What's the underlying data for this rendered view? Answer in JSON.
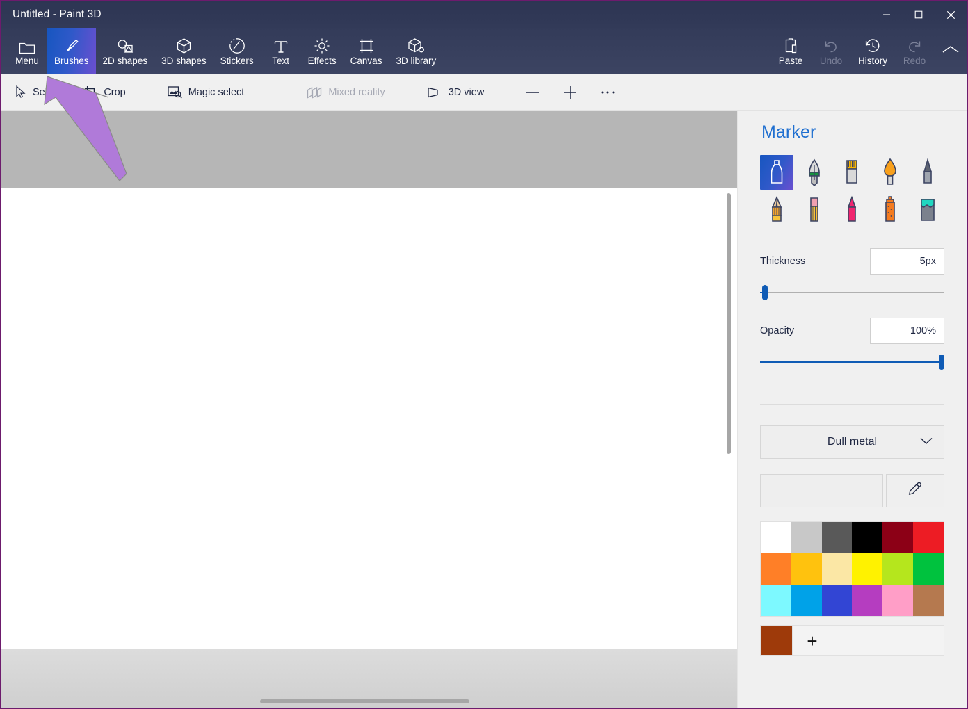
{
  "window": {
    "title": "Untitled - Paint 3D",
    "controls": [
      {
        "name": "minimize",
        "label": "Minimize"
      },
      {
        "name": "maximize",
        "label": "Maximize"
      },
      {
        "name": "close",
        "label": "Close"
      }
    ]
  },
  "ribbon": {
    "items": [
      {
        "label": "Menu",
        "icon": "folder-icon",
        "state": "normal",
        "name": "menu"
      },
      {
        "label": "Brushes",
        "icon": "brush-icon",
        "state": "selected",
        "name": "brushes"
      },
      {
        "label": "2D shapes",
        "icon": "shapes-2d-icon",
        "state": "normal",
        "name": "2d-shapes"
      },
      {
        "label": "3D shapes",
        "icon": "cube-icon",
        "state": "normal",
        "name": "3d-shapes"
      },
      {
        "label": "Stickers",
        "icon": "sticker-icon",
        "state": "normal",
        "name": "stickers"
      },
      {
        "label": "Text",
        "icon": "text-icon",
        "state": "normal",
        "name": "text"
      },
      {
        "label": "Effects",
        "icon": "sun-icon",
        "state": "normal",
        "name": "effects"
      },
      {
        "label": "Canvas",
        "icon": "canvas-icon",
        "state": "normal",
        "name": "canvas"
      },
      {
        "label": "3D library",
        "icon": "3d-library-icon",
        "state": "normal",
        "name": "3d-library"
      }
    ],
    "right_items": [
      {
        "label": "Paste",
        "icon": "clipboard-icon",
        "state": "normal",
        "name": "paste"
      },
      {
        "label": "Undo",
        "icon": "undo-icon",
        "state": "disabled",
        "name": "undo"
      },
      {
        "label": "History",
        "icon": "history-icon",
        "state": "normal",
        "name": "history"
      },
      {
        "label": "Redo",
        "icon": "redo-icon",
        "state": "disabled",
        "name": "redo"
      }
    ],
    "collapse_icon": "chevron-up-icon"
  },
  "toolbar": {
    "select_label": "Select",
    "crop_label": "Crop",
    "magic_select_label": "Magic select",
    "mixed_reality_label": "Mixed reality",
    "view_3d_label": "3D view",
    "zoom_out_label": "Zoom out",
    "zoom_in_label": "Zoom in",
    "more_label": "More options"
  },
  "panel": {
    "title": "Marker",
    "brushes": [
      {
        "name": "marker",
        "label": "Marker",
        "selected": true
      },
      {
        "name": "calligraphy-pen",
        "label": "Calligraphy pen",
        "selected": false
      },
      {
        "name": "oil-brush",
        "label": "Oil brush",
        "selected": false
      },
      {
        "name": "watercolor",
        "label": "Watercolor",
        "selected": false
      },
      {
        "name": "pixel-pen",
        "label": "Pixel pen",
        "selected": false
      },
      {
        "name": "pencil",
        "label": "Pencil",
        "selected": false
      },
      {
        "name": "eraser",
        "label": "Eraser",
        "selected": false
      },
      {
        "name": "crayon",
        "label": "Crayon",
        "selected": false
      },
      {
        "name": "spray-can",
        "label": "Spray can",
        "selected": false
      },
      {
        "name": "fill",
        "label": "Fill",
        "selected": false
      }
    ],
    "thickness": {
      "label": "Thickness",
      "value": "5px",
      "percent": 4
    },
    "opacity": {
      "label": "Opacity",
      "value": "100%",
      "percent": 100
    },
    "material": {
      "value": "Dull metal",
      "chevron": "chevron-down-icon"
    },
    "eyedropper_icon": "eyedropper-icon",
    "palette": [
      [
        "#ffffff",
        "#c8c8c8",
        "#595959",
        "#000000",
        "#8c0016",
        "#ed1c24"
      ],
      [
        "#ff7f27",
        "#ffc20e",
        "#fbe7a5",
        "#fff200",
        "#b5e61d",
        "#00c23e"
      ],
      [
        "#7df9ff",
        "#00a2e8",
        "#3245d4",
        "#b53dc0",
        "#ff9ec7",
        "#b5794f"
      ]
    ],
    "custom_color": "#9e3a0a",
    "add_color_label": "+"
  },
  "colors": {
    "accent": "#1f6fd0",
    "ribbon_bg": "#333b59",
    "selected_tab_start": "#1756c0",
    "selected_tab_end": "#6b4fd0",
    "annotation_arrow": "#b07ad9",
    "canvas_band": "#b6b6b6"
  }
}
